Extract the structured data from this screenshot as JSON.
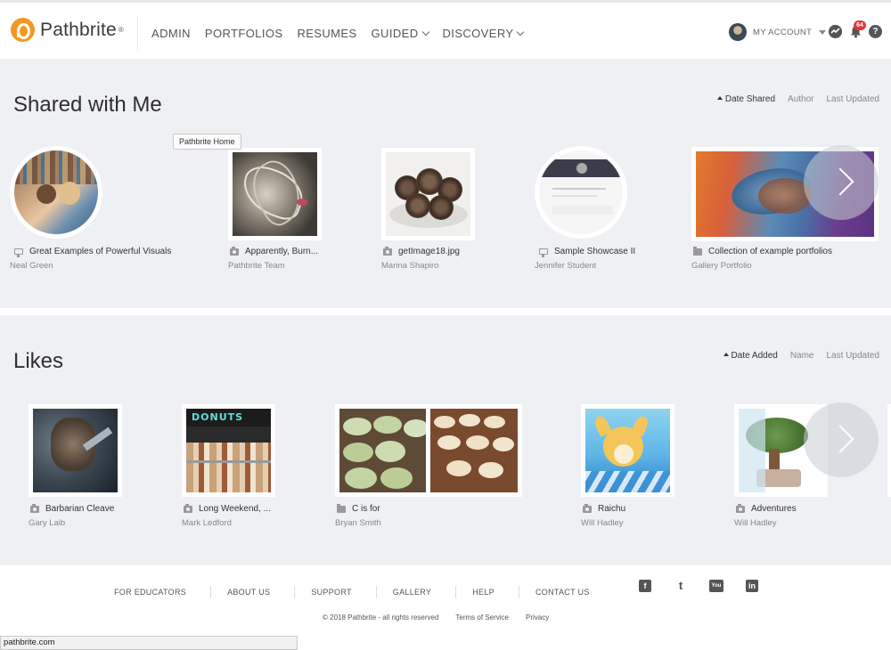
{
  "header": {
    "brand": "Pathbrite",
    "brand_mark": "®",
    "nav": [
      {
        "label": "ADMIN",
        "dropdown": false
      },
      {
        "label": "PORTFOLIOS",
        "dropdown": false
      },
      {
        "label": "RESUMES",
        "dropdown": false
      },
      {
        "label": "GUIDED",
        "dropdown": true
      },
      {
        "label": "DISCOVERY",
        "dropdown": true
      }
    ],
    "account_label": "MY ACCOUNT",
    "notification_count": "64",
    "help_glyph": "?"
  },
  "tooltip": "Pathbrite Home",
  "shared": {
    "title": "Shared with Me",
    "sort": [
      "Date Shared",
      "Author",
      "Last Updated"
    ],
    "items": [
      {
        "title": "Great Examples of Powerful Visuals",
        "owner": "Neal Green",
        "type": "showcase"
      },
      {
        "title": "Apparently, Burn...",
        "owner": "Pathbrite Team",
        "type": "camera"
      },
      {
        "title": "getImage18.jpg",
        "owner": "Marina Shapiro",
        "type": "camera"
      },
      {
        "title": "Sample Showcase II",
        "owner": "Jennifer Student",
        "type": "showcase"
      },
      {
        "title": "Collection of example portfolios",
        "owner": "Gallery Portfolio",
        "type": "folder"
      }
    ]
  },
  "likes": {
    "title": "Likes",
    "sort": [
      "Date Added",
      "Name",
      "Last Updated"
    ],
    "items": [
      {
        "title": "Barbarian Cleave",
        "owner": "Gary Laib",
        "type": "camera"
      },
      {
        "title": "Long Weekend, ...",
        "owner": "Mark Ledford",
        "type": "camera",
        "sign_text": "DONUTS"
      },
      {
        "title": "C is for",
        "owner": "Bryan Smith",
        "type": "folder"
      },
      {
        "title": "Raichu",
        "owner": "Will Hadley",
        "type": "camera"
      },
      {
        "title": "Adventures",
        "owner": "Will Hadley",
        "type": "camera"
      }
    ]
  },
  "footer": {
    "links": [
      "FOR EDUCATORS",
      "ABOUT US",
      "SUPPORT",
      "GALLERY",
      "HELP",
      "CONTACT US"
    ],
    "social": [
      {
        "icon": "facebook-icon",
        "glyph": "f"
      },
      {
        "icon": "twitter-icon",
        "glyph": "t"
      },
      {
        "icon": "youtube-icon",
        "glyph": "You"
      },
      {
        "icon": "linkedin-icon",
        "glyph": "in"
      }
    ],
    "copyright": "© 2018 Pathbrite - all rights reserved",
    "terms": "Terms of Service",
    "privacy": "Privacy"
  },
  "status_url": "pathbrite.com",
  "colors": {
    "brand": "#f29822",
    "section_bg": "#eef0f3",
    "badge": "#e1393b"
  }
}
